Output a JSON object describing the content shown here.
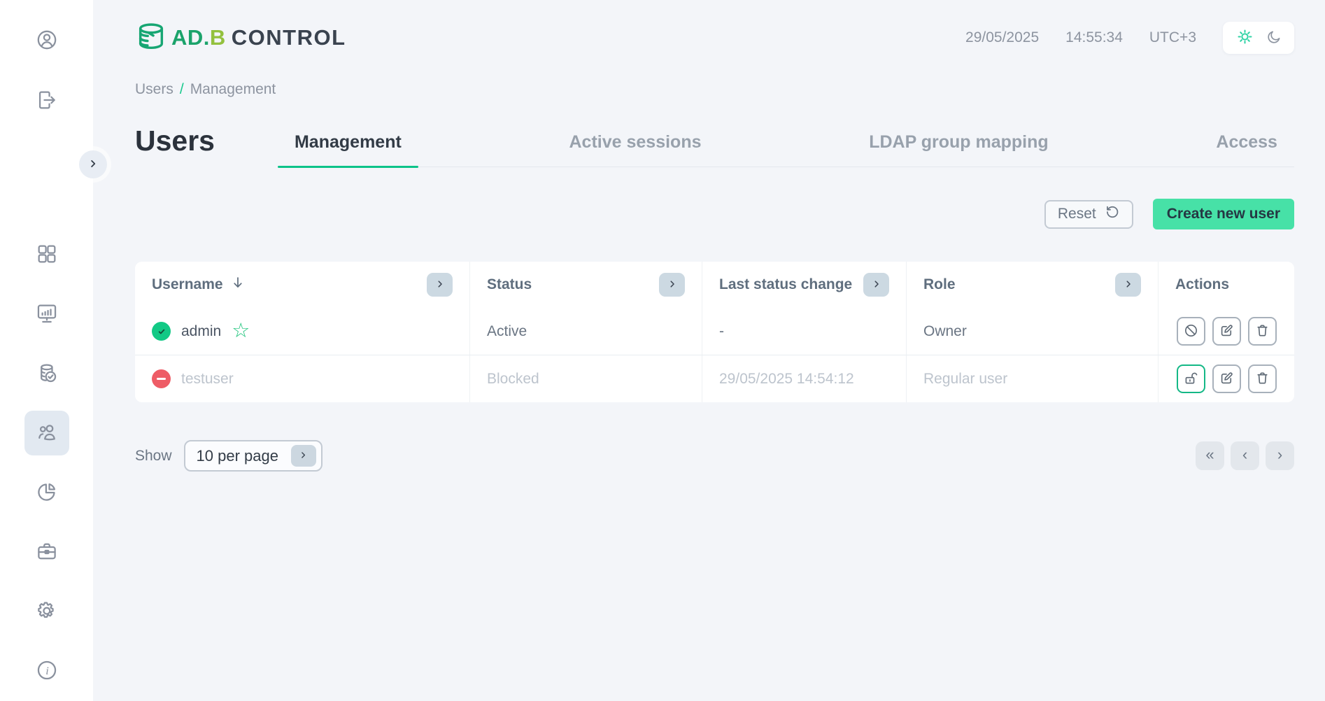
{
  "app": {
    "logo": {
      "part_green": "AD.",
      "part_lime": "B",
      "part_dark": "CONTROL"
    },
    "datetime": {
      "date": "29/05/2025",
      "time": "14:55:34",
      "timezone": "UTC+3"
    }
  },
  "sidebar": {
    "items": [
      "profile",
      "logout",
      "expand",
      "dashboard",
      "monitoring",
      "backup",
      "users",
      "statistics",
      "jobs",
      "settings",
      "about"
    ],
    "active_item": "users"
  },
  "breadcrumb": {
    "items": [
      "Users",
      "Management"
    ],
    "separator": "/"
  },
  "page": {
    "title": "Users"
  },
  "tabs": [
    {
      "label": "Management",
      "active": true
    },
    {
      "label": "Active sessions",
      "active": false
    },
    {
      "label": "LDAP group mapping",
      "active": false
    },
    {
      "label": "Access",
      "active": false
    }
  ],
  "toolbar": {
    "reset_label": "Reset",
    "create_label": "Create new user"
  },
  "table": {
    "columns": [
      "Username",
      "Status",
      "Last status change",
      "Role",
      "Actions"
    ],
    "sorted_column": "Username",
    "sort_direction": "desc",
    "rows": [
      {
        "username": "admin",
        "status": "Active",
        "last_status_change": "-",
        "role": "Owner",
        "state": "active",
        "favorite": true,
        "actions": [
          "block",
          "edit",
          "delete"
        ]
      },
      {
        "username": "testuser",
        "status": "Blocked",
        "last_status_change": "29/05/2025 14:54:12",
        "role": "Regular user",
        "state": "blocked",
        "favorite": false,
        "actions": [
          "unblock",
          "edit",
          "delete"
        ]
      }
    ]
  },
  "pagination": {
    "show_label": "Show",
    "per_page_value": "10 per page",
    "first_glyph": "«",
    "prev_glyph": "‹",
    "next_glyph": "›"
  },
  "icons": {
    "star": "☆"
  },
  "colors": {
    "accent_green": "#18c98c",
    "tab_underline": "#0cc389",
    "create_button": "#47e1a7",
    "active_dot": "#12c985",
    "blocked_dot": "#ee5c66",
    "logo_green": "#1ba36b",
    "logo_lime": "#93c13e"
  }
}
